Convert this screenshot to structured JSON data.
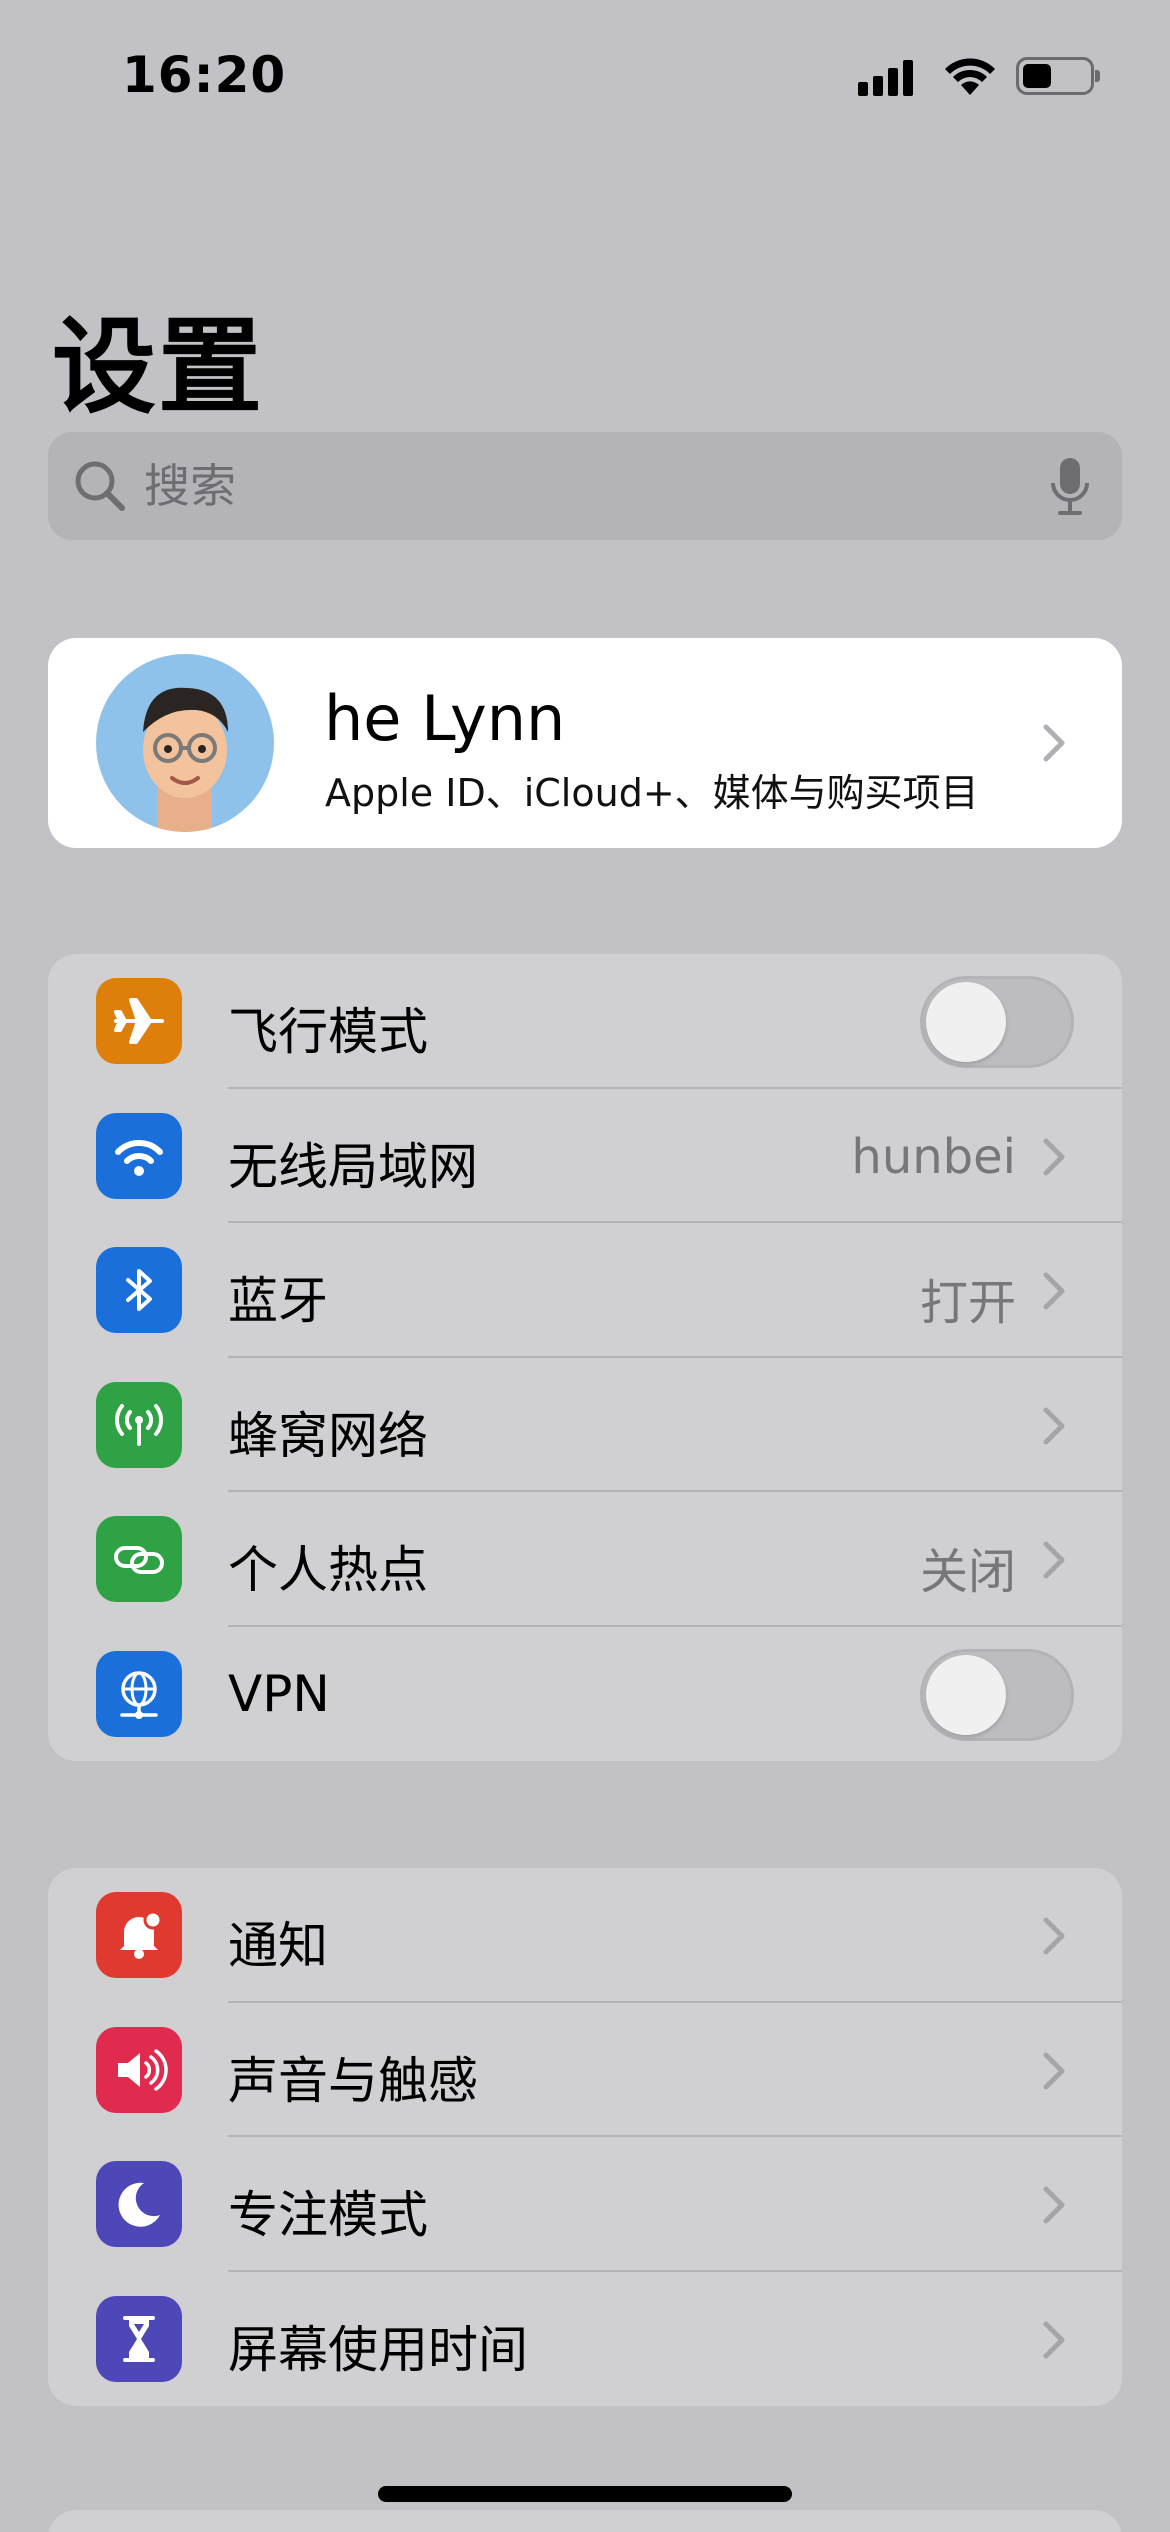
{
  "status_bar": {
    "time": "16:20",
    "battery_level": 0.44
  },
  "page_title": "设置",
  "search": {
    "placeholder": "搜索"
  },
  "profile": {
    "name": "he Lynn",
    "subtitle": "Apple ID、iCloud+、媒体与购买项目"
  },
  "connectivity_group": [
    {
      "label": "飞行模式",
      "icon": "airplane-icon",
      "color": "#df7f0b",
      "control": "toggle",
      "on": false
    },
    {
      "label": "无线局域网",
      "icon": "wifi-icon",
      "color": "#1a6fdb",
      "value": "hunbei"
    },
    {
      "label": "蓝牙",
      "icon": "bluetooth-icon",
      "color": "#1a6fdb",
      "value": "打开"
    },
    {
      "label": "蜂窝网络",
      "icon": "cellular-antenna-icon",
      "color": "#2ea245",
      "value": ""
    },
    {
      "label": "个人热点",
      "icon": "hotspot-link-icon",
      "color": "#2ea245",
      "value": "关闭"
    },
    {
      "label": "VPN",
      "icon": "vpn-globe-icon",
      "color": "#1a6fdb",
      "control": "toggle",
      "on": false
    }
  ],
  "system_group": [
    {
      "label": "通知",
      "icon": "notification-bell-icon",
      "color": "#e03a30"
    },
    {
      "label": "声音与触感",
      "icon": "speaker-icon",
      "color": "#e02a4e"
    },
    {
      "label": "专注模式",
      "icon": "moon-icon",
      "color": "#4d47b8"
    },
    {
      "label": "屏幕使用时间",
      "icon": "hourglass-icon",
      "color": "#4d47b8"
    }
  ]
}
